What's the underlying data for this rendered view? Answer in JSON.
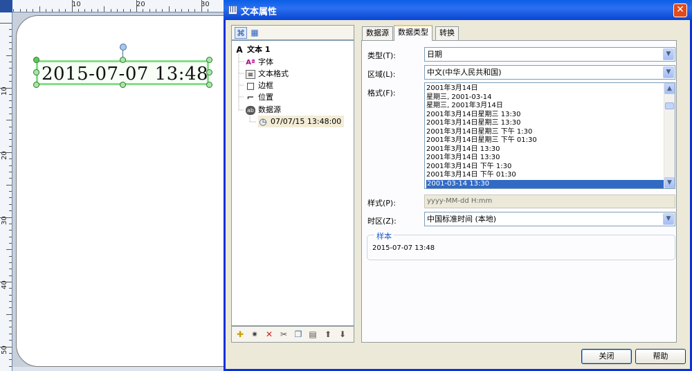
{
  "designer": {
    "ruler_top_labels": [
      "10",
      "20",
      "30"
    ],
    "ruler_left_labels": [
      "10",
      "20",
      "30",
      "40",
      "50"
    ],
    "text_object_value": "2015-07-07  13:48"
  },
  "dialog": {
    "title": "文本属性",
    "title_icon": "dialog-app-icon",
    "close_glyph": "✕"
  },
  "tree": {
    "items": [
      {
        "label": "文本 1",
        "icon": "text-object-icon",
        "glyph": "A"
      },
      {
        "label": "字体",
        "icon": "font-icon",
        "glyph": "Aª"
      },
      {
        "label": "文本格式",
        "icon": "text-format-icon",
        "glyph": "≡"
      },
      {
        "label": "边框",
        "icon": "border-icon",
        "glyph": "□"
      },
      {
        "label": "位置",
        "icon": "position-icon",
        "glyph": "⌐"
      },
      {
        "label": "数据源",
        "icon": "datasource-icon",
        "glyph": "ab"
      },
      {
        "label": "07/07/15 13:48:00",
        "icon": "clock-icon",
        "glyph": "◷"
      }
    ]
  },
  "tabs": [
    {
      "label": "数据源"
    },
    {
      "label": "数据类型"
    },
    {
      "label": "转换"
    }
  ],
  "form": {
    "type_label": "类型(T):",
    "type_value": "日期",
    "region_label": "区域(L):",
    "region_value": "中文(中华人民共和国)",
    "format_label": "格式(F):",
    "format_items": [
      "2001年3月14日",
      "星期三, 2001-03-14",
      "星期三, 2001年3月14日",
      "2001年3月14日星期三 13:30",
      "2001年3月14日星期三 13:30",
      "2001年3月14日星期三 下午 1:30",
      "2001年3月14日星期三 下午 01:30",
      "2001年3月14日 13:30",
      "2001年3月14日 13:30",
      "2001年3月14日 下午 1:30",
      "2001年3月14日 下午 01:30",
      "2001-03-14 13:30"
    ],
    "style_label": "样式(P):",
    "style_value": "yyyy-MM-dd H:mm",
    "tz_label": "时区(Z):",
    "tz_value": "中国标准时间 (本地)",
    "sample_legend": "样本",
    "sample_value": "2015-07-07 13:48"
  },
  "buttons": {
    "close": "关闭",
    "help": "帮助"
  }
}
